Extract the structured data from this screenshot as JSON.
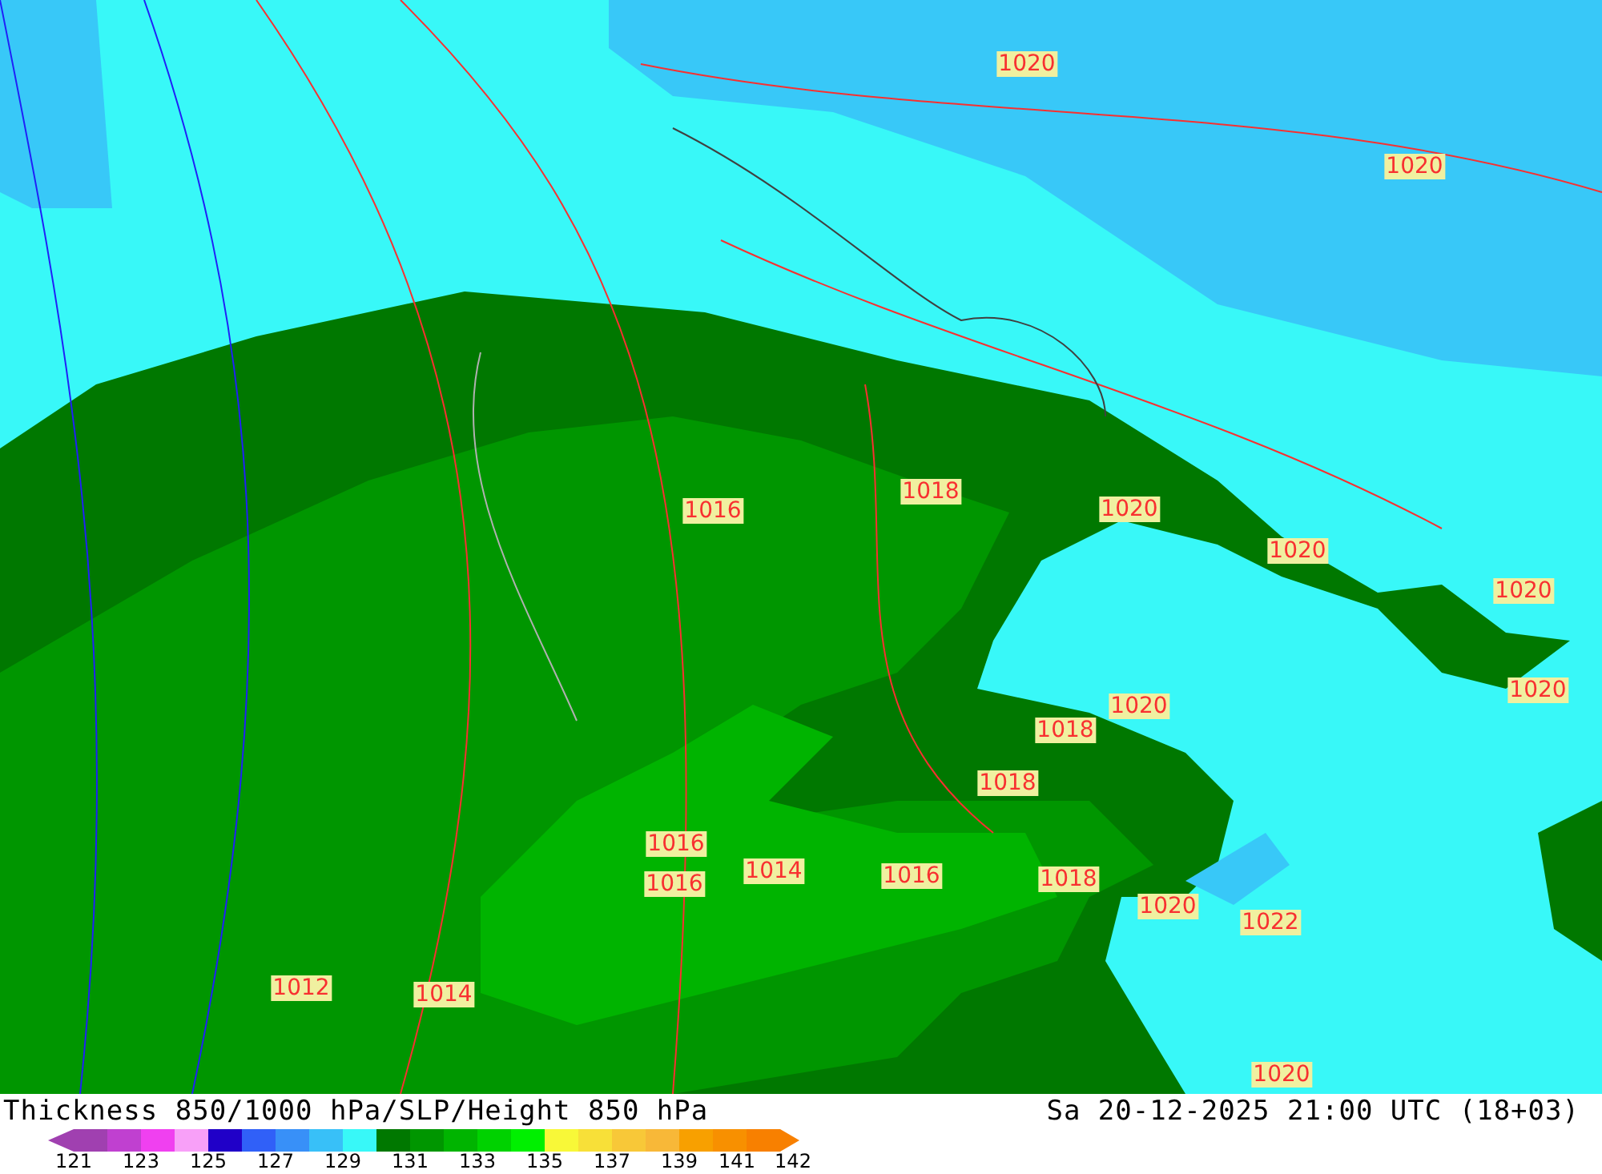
{
  "isobar_labels": [
    "1020",
    "1020",
    "1016",
    "1018",
    "1020",
    "1020",
    "1020",
    "1020",
    "1020",
    "1018",
    "1018",
    "1016",
    "1016",
    "1014",
    "1016",
    "1018",
    "1020",
    "1022",
    "1012",
    "1014",
    "1020"
  ],
  "title": "Thickness 850/1000 hPa/SLP/Height 850 hPa",
  "valid_time": "Sa 20-12-2025 21:00 UTC (18+03)",
  "legend": {
    "swatches": [
      {
        "color": "#a040b0"
      },
      {
        "color": "#c040d0"
      },
      {
        "color": "#f040f0"
      },
      {
        "color": "#f8a0f8"
      },
      {
        "color": "#2000c8"
      },
      {
        "color": "#3060f8"
      },
      {
        "color": "#3890f8"
      },
      {
        "color": "#38c0f8"
      },
      {
        "color": "#38f8f8"
      },
      {
        "color": "#007800"
      },
      {
        "color": "#009600"
      },
      {
        "color": "#00b400"
      },
      {
        "color": "#00d200"
      },
      {
        "color": "#00f000"
      },
      {
        "color": "#f8f838"
      },
      {
        "color": "#f8e038"
      },
      {
        "color": "#f8c838"
      },
      {
        "color": "#f8b838"
      },
      {
        "color": "#f8a000"
      },
      {
        "color": "#f89000"
      },
      {
        "color": "#f88000"
      }
    ],
    "labels": [
      "121",
      "123",
      "125",
      "127",
      "129",
      "131",
      "133",
      "135",
      "137",
      "139",
      "141",
      "142"
    ]
  }
}
